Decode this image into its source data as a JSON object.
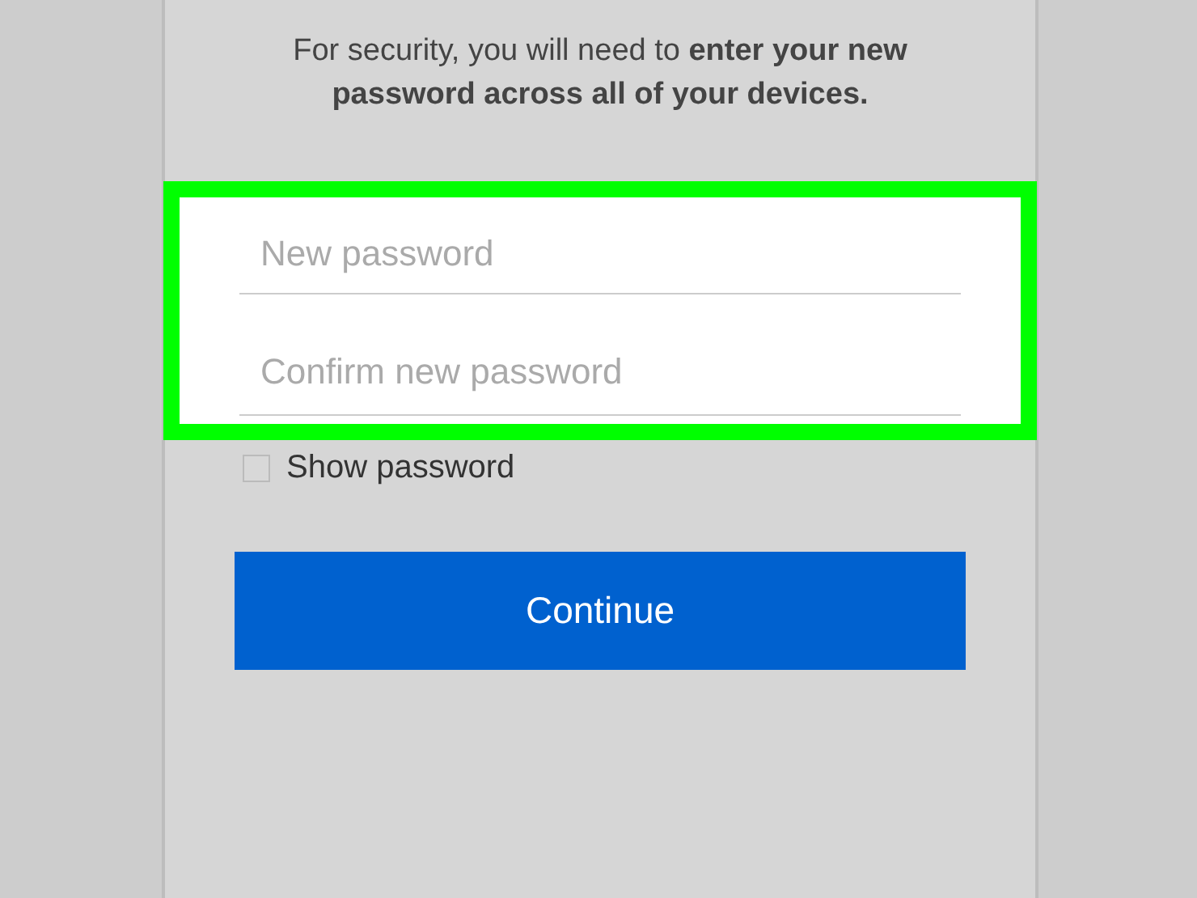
{
  "message": "For security, you will need to **enter your new password across all of your devices.**",
  "form": {
    "highlighted": true,
    "fields": [
      {
        "placeholder": "New password"
      },
      {
        "placeholder": "Confirm new password"
      }
    ]
  },
  "show_password": {
    "label": "Show password",
    "checked": false
  },
  "button": {
    "label": "Continue"
  }
}
